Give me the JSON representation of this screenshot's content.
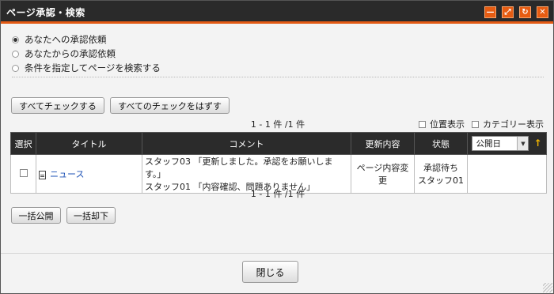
{
  "window": {
    "title": "ページ承認・検索",
    "buttons": [
      {
        "icon": "minimize-icon",
        "glyph": "—"
      },
      {
        "icon": "maximize-icon",
        "glyph": "⤢"
      },
      {
        "icon": "refresh-icon",
        "glyph": "↻"
      },
      {
        "icon": "close-icon",
        "glyph": "✕"
      }
    ]
  },
  "filters": {
    "options": [
      {
        "label": "あなたへの承認依頼",
        "selected": true
      },
      {
        "label": "あなたからの承認依頼",
        "selected": false
      },
      {
        "label": "条件を指定してページを検索する",
        "selected": false
      }
    ]
  },
  "actions": {
    "check_all": "すべてチェックする",
    "uncheck_all": "すべてのチェックをはずす"
  },
  "pager": {
    "top": "1 - 1 件 /1 件",
    "bottom": "1 - 1 件 /1 件"
  },
  "display_options": {
    "position": "位置表示",
    "category": "カテゴリー表示"
  },
  "table": {
    "headers": {
      "select": "選択",
      "title": "タイトル",
      "comment": "コメント",
      "update": "更新内容",
      "status": "状態"
    },
    "sort": {
      "selected": "公開日",
      "direction_icon": "sort-ascending-icon",
      "direction_glyph": "↑"
    },
    "rows": [
      {
        "title": "ニュース",
        "comment_line1": "スタッフ03 「更新しました。承認をお願いします。」",
        "comment_line2": "スタッフ01 「内容確認、問題ありません」",
        "update": "ページ内容変更",
        "status_line1": "承認待ち",
        "status_line2": "スタッフ01",
        "date": ""
      }
    ]
  },
  "bulk": {
    "publish": "一括公開",
    "reject": "一括却下"
  },
  "footer": {
    "close": "閉じる"
  },
  "colors": {
    "titlebar": "#2a2a2a",
    "accent": "#e65c12",
    "table_header": "#2b2b2b",
    "link": "#1a4fb5",
    "sort_arrow": "#f0b400"
  }
}
